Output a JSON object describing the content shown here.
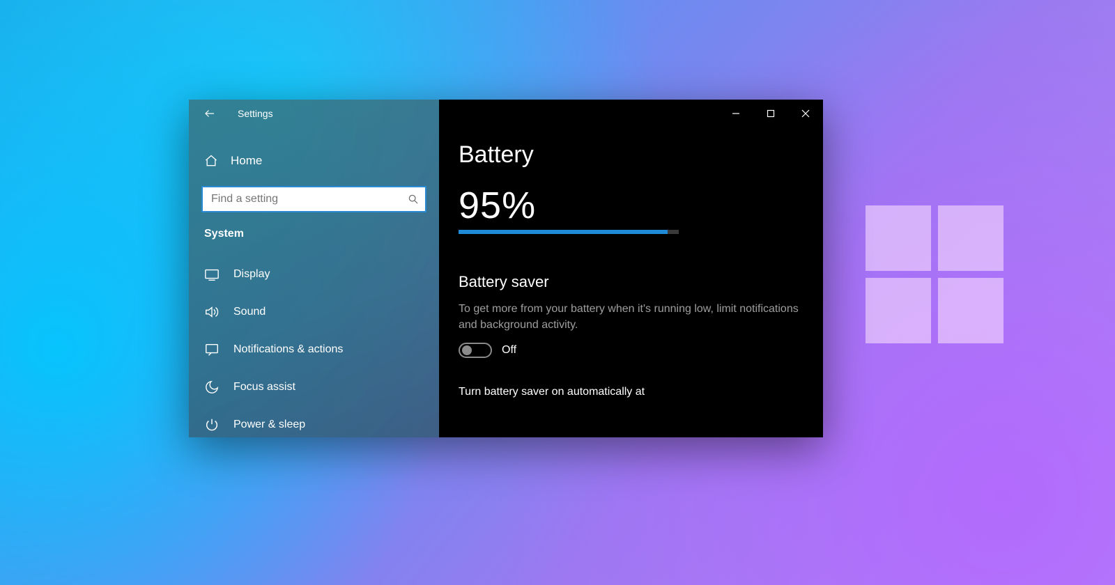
{
  "window": {
    "title": "Settings"
  },
  "sidebar": {
    "home": "Home",
    "search_placeholder": "Find a setting",
    "category": "System",
    "items": [
      {
        "icon": "display",
        "label": "Display"
      },
      {
        "icon": "sound",
        "label": "Sound"
      },
      {
        "icon": "notifications",
        "label": "Notifications & actions"
      },
      {
        "icon": "focus",
        "label": "Focus assist"
      },
      {
        "icon": "power",
        "label": "Power & sleep"
      }
    ]
  },
  "content": {
    "page_title": "Battery",
    "percent_value": 95,
    "percent_display": "95%",
    "saver_heading": "Battery saver",
    "saver_desc": "To get more from your battery when it's running low, limit notifications and background activity.",
    "saver_toggle_state": "Off",
    "auto_label": "Turn battery saver on automatically at"
  },
  "colors": {
    "accent": "#1f8ad6"
  }
}
